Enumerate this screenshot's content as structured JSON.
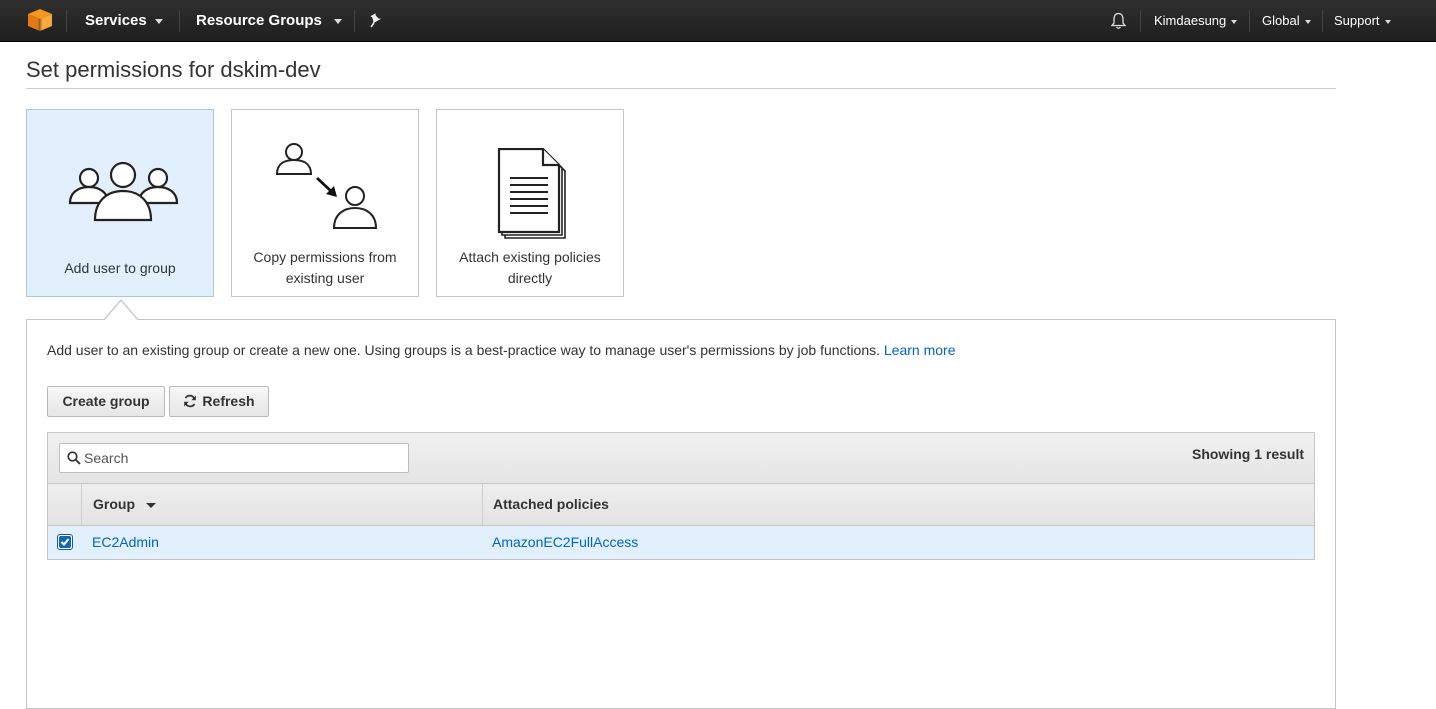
{
  "topbar": {
    "services_label": "Services",
    "resource_groups_label": "Resource Groups",
    "account_label": "Kimdaesung",
    "region_label": "Global",
    "support_label": "Support"
  },
  "page": {
    "title": "Set permissions for dskim-dev"
  },
  "options": [
    {
      "label": "Add user to group",
      "selected": true
    },
    {
      "label": "Copy permissions from existing user",
      "selected": false
    },
    {
      "label": "Attach existing policies directly",
      "selected": false
    }
  ],
  "panel": {
    "description": "Add user to an existing group or create a new one. Using groups is a best-practice way to manage user's permissions by job functions.",
    "learn_more": "Learn more",
    "create_group_label": "Create group",
    "refresh_label": "Refresh"
  },
  "table": {
    "search_placeholder": "Search",
    "result_count": "Showing 1 result",
    "columns": [
      "Group",
      "Attached policies"
    ],
    "rows": [
      {
        "group": "EC2Admin",
        "policies": "AmazonEC2FullAccess",
        "checked": true
      }
    ]
  },
  "colors": {
    "topbar": "#232f3e",
    "link": "#0066c0",
    "selected_bg": "#e1f0fc",
    "logo_orange": "#f7981d"
  }
}
